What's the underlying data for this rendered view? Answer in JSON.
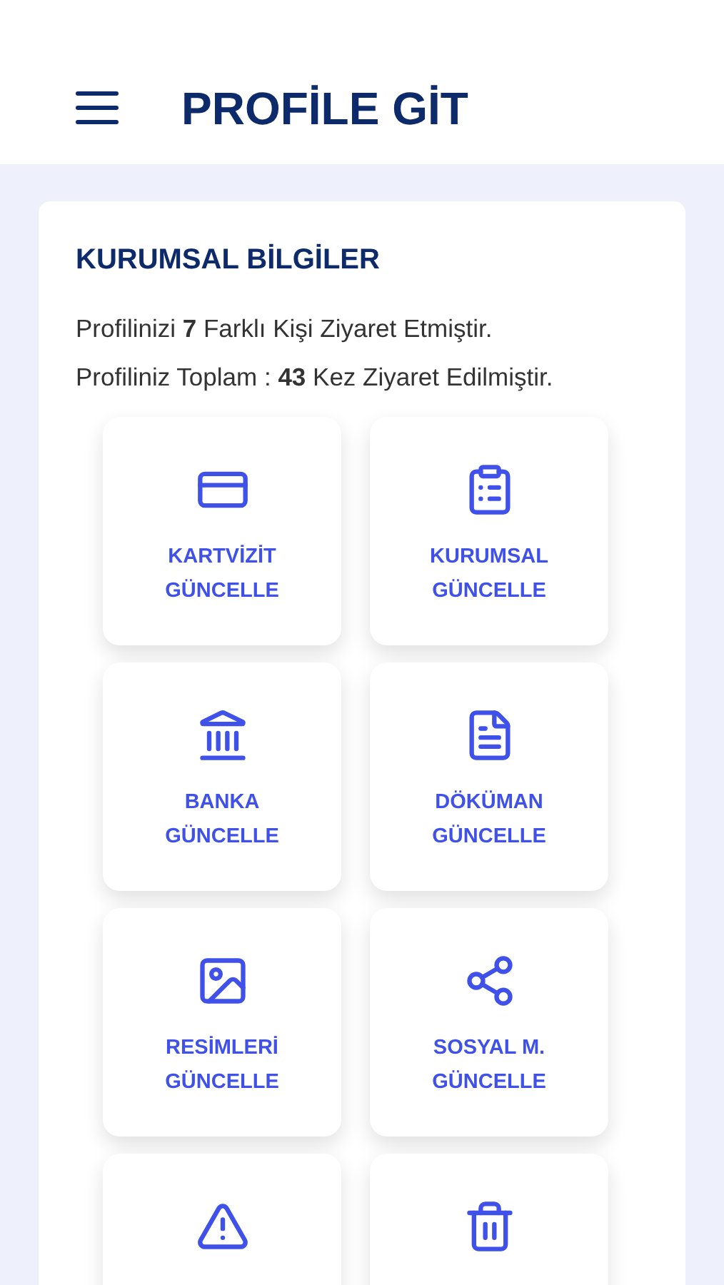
{
  "header": {
    "title": "PROFİLE GİT"
  },
  "card": {
    "title": "KURUMSAL BİLGİLER",
    "stats": [
      "Profilinizi **7** Farklı Kişi Ziyaret Etmiştir.",
      "Profiliniz Toplam : **43** Kez Ziyaret Edilmiştir."
    ],
    "tiles": [
      {
        "kind": "card",
        "lines": [
          "KARTVİZİT",
          "GÜNCELLE"
        ]
      },
      {
        "kind": "clipboard",
        "lines": [
          "KURUMSAL",
          "GÜNCELLE"
        ]
      },
      {
        "kind": "bank",
        "lines": [
          "BANKA",
          "GÜNCELLE"
        ]
      },
      {
        "kind": "document",
        "lines": [
          "DÖKÜMAN",
          "GÜNCELLE"
        ]
      },
      {
        "kind": "image",
        "lines": [
          "RESİMLERİ",
          "GÜNCELLE"
        ]
      },
      {
        "kind": "share",
        "lines": [
          "SOSYAL M.",
          "GÜNCELLE"
        ]
      },
      {
        "kind": "warning"
      },
      {
        "kind": "trash"
      }
    ]
  }
}
